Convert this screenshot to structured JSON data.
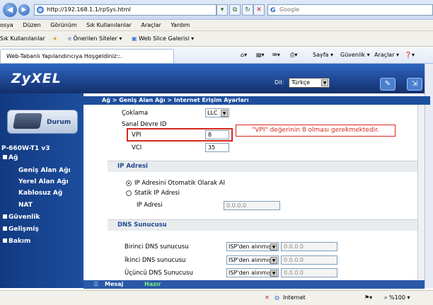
{
  "browser": {
    "url": "http://192.168.1.1/rpSys.html",
    "search_placeholder": "Google",
    "menu": [
      "osya",
      "Düzen",
      "Görünüm",
      "Sık Kullanılanlar",
      "Araçlar",
      "Yardım"
    ],
    "favorites": {
      "title": "Sık Kullanılanlar",
      "suggested": "Önerilen Siteler ▾",
      "webslice": "Web Slice Galerisi ▾"
    },
    "tab_title": "Web-Tabanlı Yapılandırıcıya Hoşgeldiniz::.",
    "tools": {
      "sayfa": "Sayfa ▾",
      "guvenlik": "Güvenlik ▾",
      "araclar": "Araçlar ▾",
      "help": "❓▾"
    },
    "status": {
      "internet": "Internet",
      "zoom": "%100 ▾"
    }
  },
  "header": {
    "logo": "ZyXEL",
    "lang_label": "Dil:",
    "lang_value": "Türkçe"
  },
  "sidebar": {
    "durum": "Durum",
    "model": "P-660W-T1 v3",
    "ag": "Ağ",
    "ag_items": [
      "Geniş Alan Ağı",
      "Yerel Alan Ağı",
      "Kablosuz Ağ",
      "NAT"
    ],
    "guvenlik": "Güvenlik",
    "gelismis": "Gelişmiş",
    "bakim": "Bakım"
  },
  "breadcrumb": "Ağ > Geniş Alan Ağı > Internet Erişim Ayarları",
  "form": {
    "coklama_label": "Çoklama",
    "coklama_value": "LLC",
    "sanal_label": "Sanal Devre ID",
    "vpi_label": "VPI",
    "vpi_value": "8",
    "vci_label": "VCI",
    "vci_value": "35",
    "note": "\"VPI\" değerinin 8 olması gerekmektedir.",
    "ip_section": "IP Adresi",
    "ip_auto": "IP Adresini Otomatik Olarak Al",
    "ip_static": "Statik IP Adresi",
    "ip_label": "IP Adresi",
    "ip_value": "0.0.0.0",
    "dns_section": "DNS Sunucusu",
    "dns_rows": [
      {
        "label": "Birinci DNS sunucusu",
        "select": "ISP'den alınmış",
        "value": "0.0.0.0"
      },
      {
        "label": "İkinci DNS sunucusu",
        "select": "ISP'den alınmış",
        "value": "0.0.0.0"
      },
      {
        "label": "Üçüncü DNS Sunucusu",
        "select": "ISP'den alınmış",
        "value": "0.0.0.0"
      }
    ]
  },
  "statusbar": {
    "mesaj": "Mesaj",
    "hazir": "Hazır"
  }
}
